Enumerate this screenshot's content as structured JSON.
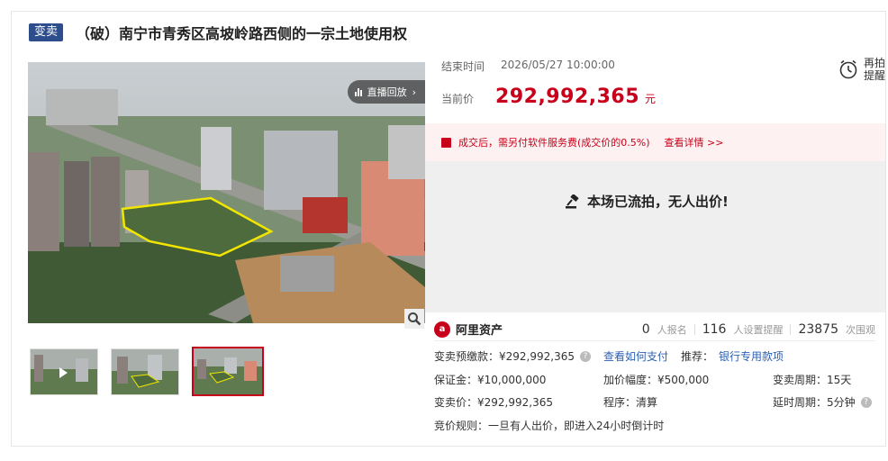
{
  "header": {
    "tag": "变卖",
    "title": "（破）南宁市青秀区高坡岭路西侧的一宗土地使用权"
  },
  "gallery": {
    "live_button": "直播回放",
    "thumb_count": 3,
    "active_thumb": 3
  },
  "auction": {
    "end_label": "结束时间",
    "end_time": "2026/05/27 10:00:00",
    "price_label": "当前价",
    "price": "292,992,365",
    "price_unit": "元",
    "remind_label": "再拍提醒",
    "fee_note": "成交后，需另付软件服务费(成交价的0.5%)",
    "fee_detail": "查看详情 >>",
    "status": "本场已流拍，无人出价!"
  },
  "platform": {
    "name": "阿里资产",
    "signups_value": "0",
    "signups_label": "人报名",
    "reminders_value": "116",
    "reminders_label": "人设置提醒",
    "views_value": "23875",
    "views_label": "次围观"
  },
  "details": {
    "deposit_pre_label": "变卖预缴款：",
    "deposit_pre_value": "¥292,992,365",
    "how_to_pay": "查看如何支付",
    "recommend_label": "推荐：",
    "recommend_link": "银行专用款项",
    "security_label": "保证金：",
    "security_value": "¥10,000,000",
    "increment_label": "加价幅度：",
    "increment_value": "¥500,000",
    "period_label": "变卖周期：",
    "period_value": "15天",
    "sale_price_label": "变卖价：",
    "sale_price_value": "¥292,992,365",
    "procedure_label": "程序：",
    "procedure_value": "清算",
    "delay_label": "延时周期：",
    "delay_value": "5分钟",
    "rule_label": "竞价规则：",
    "rule_value": "一旦有人出价，即进入24小时倒计时"
  },
  "colors": {
    "accent_red": "#c7001b",
    "tag_blue": "#2e4d8c",
    "link_blue": "#2d5fb3"
  }
}
